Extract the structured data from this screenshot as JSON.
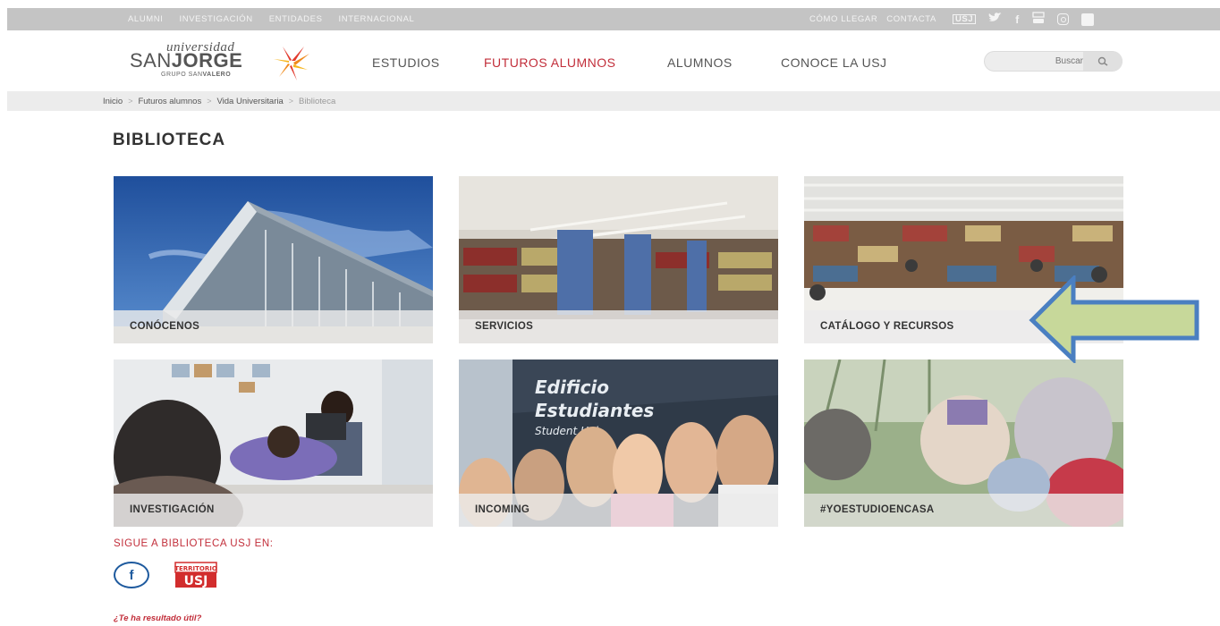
{
  "topbar": {
    "left_links": [
      "ALUMNI",
      "INVESTIGACIÓN",
      "ENTIDADES",
      "INTERNACIONAL"
    ],
    "right_links": [
      "CÓMO LLEGAR",
      "CONTACTA"
    ],
    "social_icons": [
      "usj-icon",
      "twitter-icon",
      "facebook-icon",
      "youtube-icon",
      "instagram-icon",
      "linkedin-icon"
    ],
    "usj_label": "USJ",
    "facebook_glyph": "f",
    "linkedin_glyph": "in"
  },
  "logo": {
    "line1": "universidad",
    "line2_light": "SAN",
    "line2_bold": "JORGE",
    "line3_light": "GRUPO SAN",
    "line3_bold": "VALERO"
  },
  "nav": {
    "items": [
      {
        "label": "ESTUDIOS",
        "active": false
      },
      {
        "label": "FUTUROS ALUMNOS",
        "active": true
      },
      {
        "label": "ALUMNOS",
        "active": false
      },
      {
        "label": "CONOCE LA USJ",
        "active": false
      }
    ]
  },
  "search": {
    "placeholder": "Buscar"
  },
  "breadcrumb": {
    "items": [
      "Inicio",
      "Futuros alumnos",
      "Vida Universitaria",
      "Biblioteca"
    ],
    "separator": ">"
  },
  "page": {
    "title": "BIBLIOTECA"
  },
  "tiles": [
    {
      "label": "CONÓCENOS"
    },
    {
      "label": "SERVICIOS"
    },
    {
      "label": "CATÁLOGO Y RECURSOS"
    },
    {
      "label": "INVESTIGACIÓN"
    },
    {
      "label": "INCOMING"
    },
    {
      "label": "#YOESTUDIOENCASA"
    }
  ],
  "incoming_sign": {
    "line1": "Edificio",
    "line2": "Estudiantes",
    "line3": "Student Hub"
  },
  "follow": {
    "heading": "SIGUE A BIBLIOTECA USJ EN:",
    "facebook_glyph": "f",
    "territorio_top": "TERRITORIO",
    "territorio_bottom": "USJ"
  },
  "feedback": {
    "question": "¿Te ha resultado útil?"
  },
  "colors": {
    "accent": "#c22e3a",
    "topbar": "#c4c4c4",
    "arrow_fill": "#c7d89a",
    "arrow_stroke": "#4a7fc1"
  }
}
